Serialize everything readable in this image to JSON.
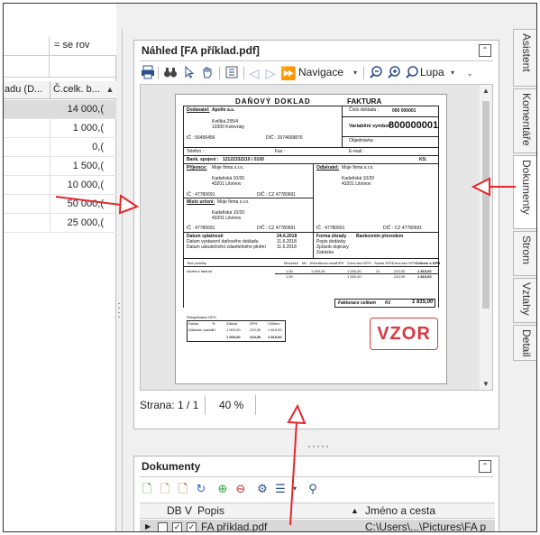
{
  "left_grid": {
    "top_col_b": "= se rov",
    "header_col1": "adu (D...",
    "header_col2": "Č.celk. b...",
    "rows": [
      {
        "value": "14 000,(",
        "shade": true
      },
      {
        "value": "1 000,(",
        "shade": false
      },
      {
        "value": "0,(",
        "shade": false
      },
      {
        "value": "1 500,(",
        "shade": false
      },
      {
        "value": "10 000,(",
        "shade": false
      },
      {
        "value": "50 000,(",
        "shade": false
      },
      {
        "value": "25 000,(",
        "shade": false
      }
    ]
  },
  "preview": {
    "title": "Náhled [FA příklad.pdf]",
    "toolbar": {
      "navigation_label": "Navigace",
      "zoom_label": "Lupa"
    },
    "status": {
      "page": "Strana: 1 / 1",
      "zoom": "40 %"
    }
  },
  "document": {
    "heading": "DAŇOVÝ DOKLAD",
    "type": "FAKTURA",
    "supplier_label": "Dodavatel:",
    "supplier_name": "Apollo a.s.",
    "doc_number_label": "Číslo dokladu :",
    "doc_number": "000 000001",
    "supplier_street": "Kotlíká 255/4",
    "supplier_city": "10300 Kolovraty",
    "var_symbol_label": "Variabilní symbol:",
    "var_symbol": "800000001",
    "ic_supplier": "IČ : 56456456",
    "dic_supplier": "DIČ : 2074658876",
    "objednavka_label": "Objednávka :",
    "phone_label": "Telefon :",
    "fax_label": "Fax :",
    "email_label": "E-mail :",
    "bank_label": "Bank. spojení :",
    "bank_value": "12122332210 / 0100",
    "ks_label": "KS:",
    "recipient_label": "Příjemce:",
    "recipient_name": "Moje firma s.r.o.",
    "customer_label": "Odběratel:",
    "customer_name": "Moje firma s.r.o.",
    "recipient_street": "Kadaňská 10/20",
    "recipient_city": "43201 Litvínov",
    "customer_street": "Kadaňská 10/20",
    "customer_city": "43201 Litvínov",
    "ic_recipient": "IČ : 47780691",
    "dic_recipient": "DIČ : CZ 47780691",
    "place_label": "Místo určení:",
    "place_name": "Moje firma s.r.o.",
    "place_street": "Kadaňská 10/20",
    "place_city": "43201 Litvínov",
    "ic_place": "IČ : 47780691",
    "dic_place": "DIČ : CZ 47780691",
    "ic_customer": "IČ : 47780691",
    "dic_customer": "DIČ : CZ 47780691",
    "due_label": "Datum splatnosti",
    "due_value": "24.6.2018",
    "issued_label": "Datum vystavení daňového dokladu",
    "issued_value": "11.6.2018",
    "taxable_label": "Datum uskutečnění zdanitelného plnění",
    "taxable_value": "11.6.2018",
    "payment_label": "Forma úhrady",
    "payment_value": "Bankovním převodem",
    "delivery_note_label": "Popis dodávky",
    "transport_label": "Způsob dopravy",
    "contract_label": "Zakázka",
    "items_header": [
      "Text položky",
      "Množství",
      "MJ",
      "Jednotková cena",
      "DPH",
      "Cena bez DPH",
      "Sazba DPH",
      "Cena bez DPH",
      "Celkem s DPH"
    ],
    "item_row": [
      "sluzba k faktura",
      "1,00",
      "",
      "1 000,00",
      "",
      "1 000,00",
      "21",
      "210,00",
      "1 815,00"
    ],
    "item_sum": [
      "1,00",
      "1 000,00",
      "210,00",
      "1 815,00"
    ],
    "total_label": "Fakturace celkem",
    "total_currency": "Kč",
    "total_value": "1 815,00",
    "vat_recap_label": "Rekapitulace DPH",
    "vat_head": [
      "Sazba",
      "%",
      "Základ",
      "DPH",
      "Celkem"
    ],
    "vat_row1": [
      "Základní sazba",
      "21",
      "1 000,00",
      "210,00",
      "1 815,00"
    ],
    "vat_row2": [
      "",
      "",
      "1 000,00",
      "210,00",
      "1 815,00"
    ],
    "watermark": "VZOR"
  },
  "docs_panel": {
    "title": "Dokumenty",
    "col_db": "DB",
    "col_v": "V",
    "col_popis": "Popis",
    "col_path": "Jméno a cesta",
    "row": {
      "popis": "FA příklad.pdf",
      "path": "C:\\Users\\...\\Pictures\\FA p"
    }
  },
  "right_tabs": [
    "Asistent",
    "Komentáře",
    "Dokumenty",
    "Strom",
    "Vztahy",
    "Detail"
  ],
  "colors": {
    "accent": "#2b4f8c",
    "watermark": "#d9383f",
    "arrow": "#e8262c"
  }
}
